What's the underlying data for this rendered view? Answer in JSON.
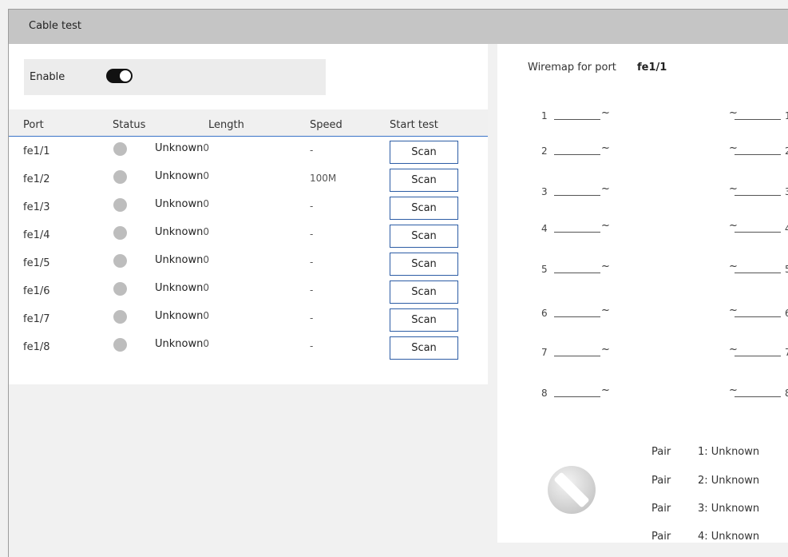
{
  "window": {
    "title": "Cable test"
  },
  "enable": {
    "label": "Enable",
    "on": true
  },
  "table": {
    "headers": {
      "port": "Port",
      "status": "Status",
      "length": "Length",
      "speed": "Speed",
      "start_test": "Start test"
    },
    "rows": [
      {
        "port": "fe1/1",
        "length": "Unknown",
        "length_num": "0",
        "speed": "-",
        "scan": "Scan"
      },
      {
        "port": "fe1/2",
        "length": "Unknown",
        "length_num": "0",
        "speed": "100M",
        "scan": "Scan"
      },
      {
        "port": "fe1/3",
        "length": "Unknown",
        "length_num": "0",
        "speed": "-",
        "scan": "Scan"
      },
      {
        "port": "fe1/4",
        "length": "Unknown",
        "length_num": "0",
        "speed": "-",
        "scan": "Scan"
      },
      {
        "port": "fe1/5",
        "length": "Unknown",
        "length_num": "0",
        "speed": "-",
        "scan": "Scan"
      },
      {
        "port": "fe1/6",
        "length": "Unknown",
        "length_num": "0",
        "speed": "-",
        "scan": "Scan"
      },
      {
        "port": "fe1/7",
        "length": "Unknown",
        "length_num": "0",
        "speed": "-",
        "scan": "Scan"
      },
      {
        "port": "fe1/8",
        "length": "Unknown",
        "length_num": "0",
        "speed": "-",
        "scan": "Scan"
      }
    ]
  },
  "wiremap": {
    "label": "Wiremap for port",
    "port": "fe1/1",
    "pins": [
      "1",
      "2",
      "3",
      "4",
      "5",
      "6",
      "7",
      "8"
    ],
    "pairs": [
      {
        "label": "Pair",
        "value": "1: Unknown"
      },
      {
        "label": "Pair",
        "value": "2: Unknown"
      },
      {
        "label": "Pair",
        "value": "3: Unknown"
      },
      {
        "label": "Pair",
        "value": "4: Unknown"
      }
    ]
  },
  "icons": {
    "toggle": "toggle-switch-icon",
    "status": "status-dot-icon",
    "disabled": "disabled-icon",
    "wire": "wire-tilde-icon"
  }
}
